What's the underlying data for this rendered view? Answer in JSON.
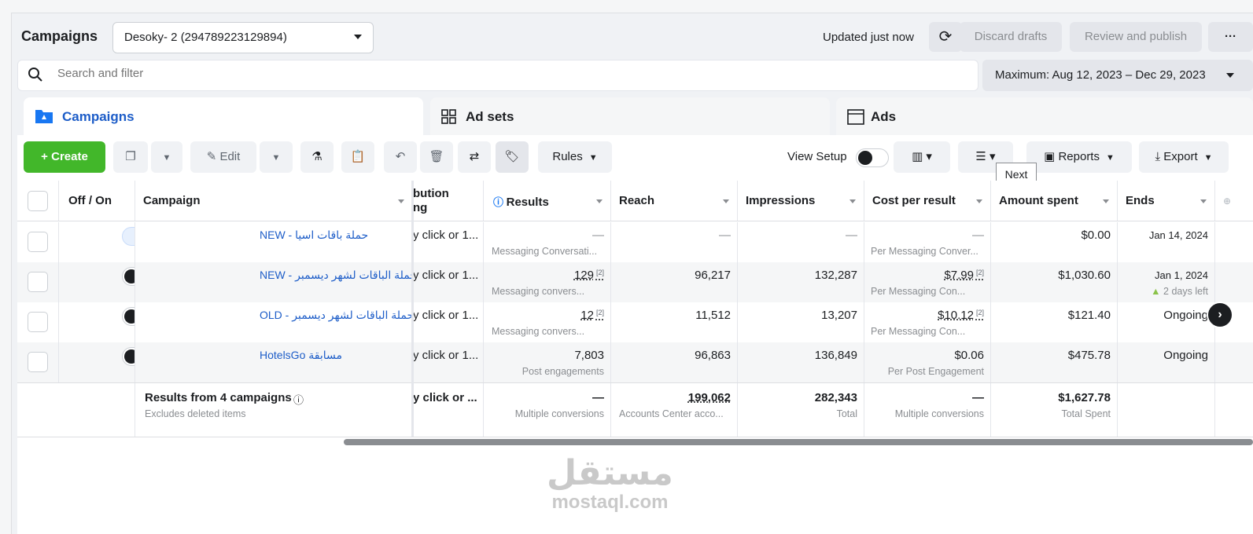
{
  "header": {
    "title": "Campaigns",
    "account": "Desoky- 2 (294789223129894)",
    "updated": "Updated just now",
    "discard": "Discard drafts",
    "review": "Review and publish",
    "more": "···"
  },
  "search": {
    "placeholder": "Search and filter"
  },
  "daterange": "Maximum: Aug 12, 2023 – Dec 29, 2023",
  "tabs": [
    {
      "label": "Campaigns"
    },
    {
      "label": "Ad sets"
    },
    {
      "label": "Ads"
    }
  ],
  "toolbar": {
    "create": "Create",
    "edit": "Edit",
    "rules": "Rules",
    "view_setup": "View Setup",
    "reports": "Reports",
    "export": "Export",
    "tooltip": "Next"
  },
  "columns": {
    "offon": "Off / On",
    "campaign": "Campaign",
    "attribution_line1": "bution",
    "attribution_line2": "ng",
    "results": "Results",
    "reach": "Reach",
    "impressions": "Impressions",
    "cpr": "Cost per result",
    "spent": "Amount spent",
    "ends": "Ends"
  },
  "rows": [
    {
      "name": "حملة باقات اسيا - NEW",
      "attr": "y click or 1...",
      "results": "—",
      "results_sub": "Messaging Conversati...",
      "reach": "—",
      "impressions": "—",
      "cpr": "—",
      "cpr_sub": "Per Messaging Conver...",
      "spent": "$0.00",
      "ends": "Jan 14, 2024",
      "ends_sub": ""
    },
    {
      "name": "حملة الباقات لشهر ديسمبر - NEW",
      "attr": "y click or 1...",
      "results": "129",
      "results_sub": "Messaging convers...",
      "reach": "96,217",
      "impressions": "132,287",
      "cpr": "$7.99",
      "cpr_sub": "Per Messaging Con...",
      "spent": "$1,030.60",
      "ends": "Jan 1, 2024",
      "ends_sub": "2 days left"
    },
    {
      "name": "حملة الباقات لشهر ديسمبر - OLD",
      "attr": "y click or 1...",
      "results": "12",
      "results_sub": "Messaging convers...",
      "reach": "11,512",
      "impressions": "13,207",
      "cpr": "$10.12",
      "cpr_sub": "Per Messaging Con...",
      "spent": "$121.40",
      "ends": "Ongoing",
      "ends_sub": ""
    },
    {
      "name": "مسابقة HotelsGo",
      "attr": "y click or 1...",
      "results": "7,803",
      "results_sub": "Post engagements",
      "reach": "96,863",
      "impressions": "136,849",
      "cpr": "$0.06",
      "cpr_sub": "Per Post Engagement",
      "spent": "$475.78",
      "ends": "Ongoing",
      "ends_sub": ""
    }
  ],
  "summary": {
    "title": "Results from 4 campaigns",
    "note": "Excludes deleted items",
    "attr": "y click or ...",
    "results": "—",
    "results_sub": "Multiple conversions",
    "reach": "199,062",
    "reach_sub": "Accounts Center acco...",
    "impressions": "282,343",
    "impressions_sub": "Total",
    "cpr": "—",
    "cpr_sub": "Multiple conversions",
    "spent": "$1,627.78",
    "spent_sub": "Total Spent"
  },
  "footnote_mark": "[2]",
  "watermark": {
    "arabic": "مستقل",
    "latin": "mostaql.com"
  },
  "colors": {
    "create": "#42b72a",
    "link": "#1d5dc8",
    "toggle_on": "#1877f2"
  }
}
